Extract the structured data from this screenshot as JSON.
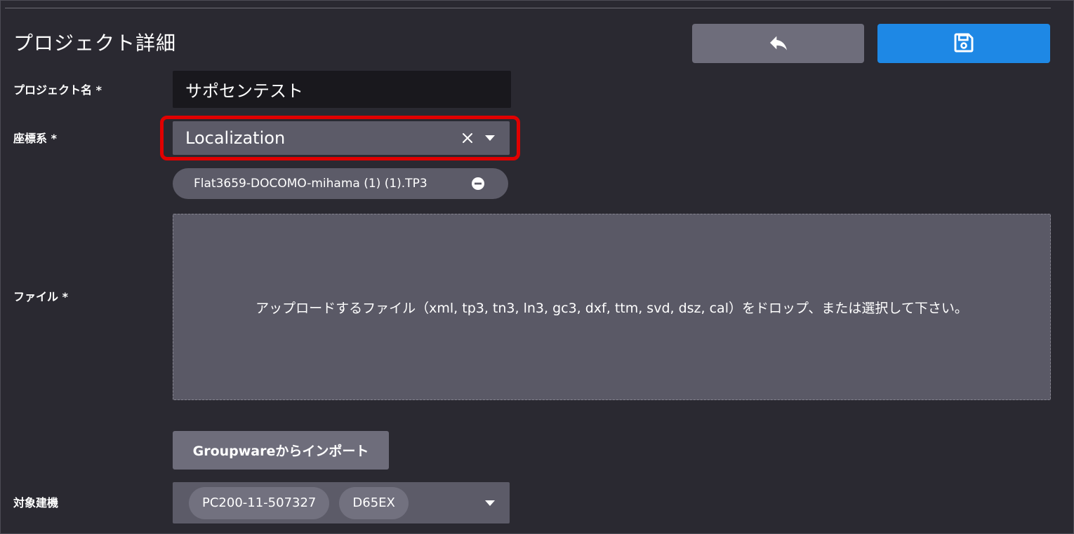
{
  "page": {
    "title": "プロジェクト詳細"
  },
  "toolbar": {
    "back_icon": "reply-arrow-icon",
    "save_icon": "floppy-disk-icon",
    "save_color": "#1e88e5"
  },
  "form": {
    "project_name": {
      "label": "プロジェクト名 *",
      "value": "サポセンテスト"
    },
    "coordinate_system": {
      "label": "座標系 *",
      "value": "Localization",
      "highlight_color": "#e10000"
    },
    "selected_file": {
      "name": "Flat3659-DOCOMO-mihama (1) (1).TP3"
    },
    "file": {
      "label": "ファイル *",
      "dropzone_text": "アップロードするファイル（xml, tp3, tn3, ln3, gc3, dxf, ttm, svd, dsz, cal）をドロップ、または選択して下さい。"
    },
    "import_button": {
      "label": "Groupwareからインポート"
    },
    "target_machine": {
      "label": "対象建機",
      "tags": [
        "PC200-11-507327",
        "D65EX"
      ]
    }
  }
}
